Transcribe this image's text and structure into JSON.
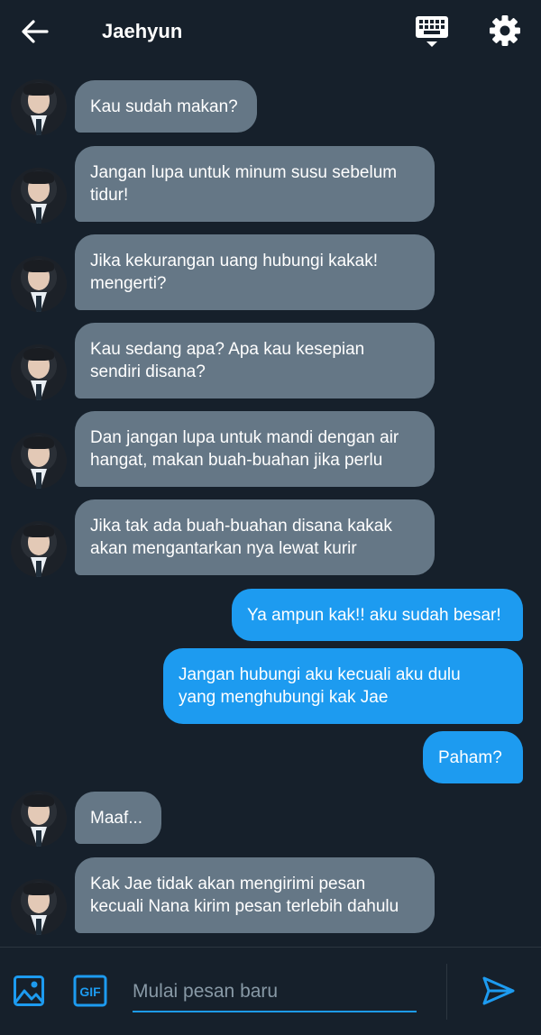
{
  "header": {
    "title": "Jaehyun",
    "back_icon": "arrow-left-icon",
    "keyboard_icon": "keyboard-icon",
    "settings_icon": "gear-icon"
  },
  "messages": [
    {
      "from": "them",
      "text": "Kau sudah makan?"
    },
    {
      "from": "them",
      "text": "Jangan lupa untuk minum susu sebelum\ntidur!"
    },
    {
      "from": "them",
      "text": "Jika kekurangan uang hubungi kakak!\nmengerti?"
    },
    {
      "from": "them",
      "text": "Kau sedang apa? Apa kau kesepian\nsendiri disana?"
    },
    {
      "from": "them",
      "text": "Dan jangan lupa untuk mandi dengan air\nhangat, makan buah-buahan jika perlu"
    },
    {
      "from": "them",
      "text": "Jika tak ada buah-buahan disana kakak\nakan mengantarkan nya lewat kurir"
    },
    {
      "from": "me",
      "text": "Ya ampun kak!! aku sudah besar!"
    },
    {
      "from": "me",
      "text": "Jangan hubungi aku kecuali aku dulu\nyang menghubungi kak Jae"
    },
    {
      "from": "me",
      "text": "Paham?"
    },
    {
      "from": "them",
      "text": "Maaf..."
    },
    {
      "from": "them",
      "text": "Kak Jae tidak akan mengirimi pesan\nkecuali Nana kirim pesan terlebih dahulu"
    }
  ],
  "composer": {
    "placeholder": "Mulai pesan baru",
    "value": "",
    "image_icon": "image-icon",
    "gif_label": "GIF",
    "send_icon": "send-icon"
  },
  "colors": {
    "background": "#16202b",
    "incoming_bubble": "#657786",
    "outgoing_bubble": "#1d9bf0",
    "accent": "#1d9bf0"
  }
}
